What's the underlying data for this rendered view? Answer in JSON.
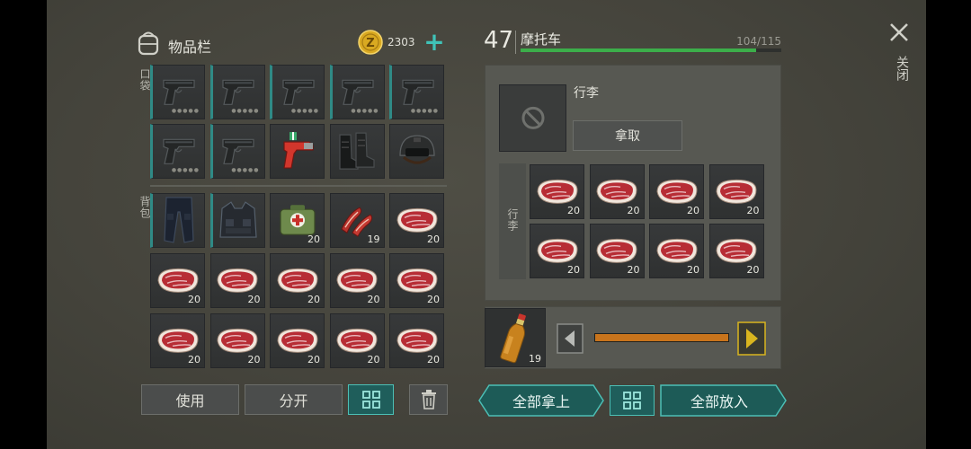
{
  "inventory": {
    "title": "物品栏",
    "coins": "2303",
    "plus": "+",
    "pockets_label": "口袋",
    "backpack_label": "背包",
    "pockets": [
      {
        "item": "pistol"
      },
      {
        "item": "pistol"
      },
      {
        "item": "pistol"
      },
      {
        "item": "pistol"
      },
      {
        "item": "pistol"
      },
      {
        "item": "pistol"
      },
      {
        "item": "pistol"
      },
      {
        "item": "flare-gun"
      },
      {
        "item": "boots"
      },
      {
        "item": "helmet"
      }
    ],
    "backpack": [
      {
        "item": "pants",
        "qty": ""
      },
      {
        "item": "vest",
        "qty": ""
      },
      {
        "item": "medkit",
        "qty": "20"
      },
      {
        "item": "bacon",
        "qty": "19"
      },
      {
        "item": "steak",
        "qty": "20"
      },
      {
        "item": "steak",
        "qty": "20"
      },
      {
        "item": "steak",
        "qty": "20"
      },
      {
        "item": "steak",
        "qty": "20"
      },
      {
        "item": "steak",
        "qty": "20"
      },
      {
        "item": "steak",
        "qty": "20"
      },
      {
        "item": "steak",
        "qty": "20"
      },
      {
        "item": "steak",
        "qty": "20"
      },
      {
        "item": "steak",
        "qty": "20"
      },
      {
        "item": "steak",
        "qty": "20"
      },
      {
        "item": "steak",
        "qty": "20"
      }
    ],
    "buttons": {
      "use": "使用",
      "split": "分开"
    }
  },
  "vehicle": {
    "level": "47",
    "name": "摩托车",
    "capacity": "104/115",
    "capacity_fraction": 0.904,
    "luggage_title": "行李",
    "take_button": "拿取",
    "luggage_side_label": "行李",
    "luggage_items": [
      {
        "item": "steak",
        "qty": "20"
      },
      {
        "item": "steak",
        "qty": "20"
      },
      {
        "item": "steak",
        "qty": "20"
      },
      {
        "item": "steak",
        "qty": "20"
      },
      {
        "item": "steak",
        "qty": "20"
      },
      {
        "item": "steak",
        "qty": "20"
      },
      {
        "item": "steak",
        "qty": "20"
      },
      {
        "item": "steak",
        "qty": "20"
      }
    ],
    "fuel": {
      "item": "fuel-bottle",
      "qty": "19",
      "level_fraction": 1.0
    },
    "buttons": {
      "take_all": "全部拿上",
      "put_all": "全部放入"
    }
  },
  "close_label": "关闭",
  "colors": {
    "accent_teal": "#2f8a86",
    "capacity_green": "#3cae4a",
    "fuel_orange": "#c8741c",
    "arrow_yellow": "#d9b51f"
  }
}
